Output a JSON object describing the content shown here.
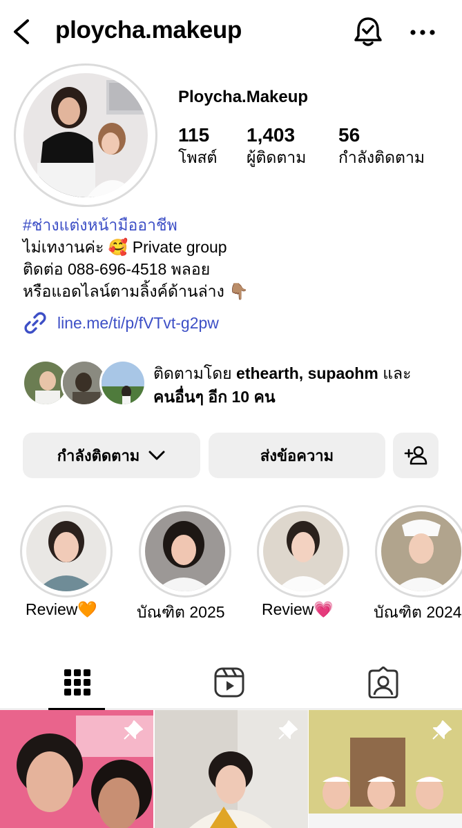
{
  "header": {
    "username": "ploycha.makeup",
    "back_icon": "chevron-left-icon",
    "bell_icon": "bell-check-icon",
    "more_icon": "more-horizontal-icon"
  },
  "profile": {
    "display_name": "Ploycha.Makeup",
    "stats": [
      {
        "value": "115",
        "label": "โพสต์"
      },
      {
        "value": "1,403",
        "label": "ผู้ติดตาม"
      },
      {
        "value": "56",
        "label": "กำลังติดตาม"
      }
    ],
    "bio": {
      "hashtag": "#ช่างแต่งหน้ามืออาชีพ",
      "line1": "ไม่เทงานค่ะ 🥰 Private group",
      "line2": "ติดต่อ 088-696-4518 พลอย",
      "line3": "หรือแอดไลน์ตามลิ้งค์ด้านล่าง 👇🏽",
      "link": "line.me/ti/p/fVTvt-g2pw"
    },
    "mutual": {
      "prefix": "ติดตามโดย ",
      "names": "ethearth, supaohm",
      "suffix_1": " และ",
      "line2": "คนอื่นๆ อีก 10 คน"
    }
  },
  "actions": {
    "following_label": "กำลังติดตาม",
    "message_label": "ส่งข้อความ",
    "add_person_icon": "add-person-icon"
  },
  "highlights": [
    {
      "label": "Review🧡"
    },
    {
      "label": "บัณฑิต 2025"
    },
    {
      "label": "Review💗"
    },
    {
      "label": "บัณฑิต 2024"
    }
  ],
  "tabs": [
    {
      "name": "grid-icon",
      "active": true
    },
    {
      "name": "reels-icon",
      "active": false
    },
    {
      "name": "tagged-icon",
      "active": false
    }
  ],
  "colors": {
    "link": "#3d4fc6",
    "button_bg": "#efefef",
    "divider": "#dbdbdb"
  }
}
